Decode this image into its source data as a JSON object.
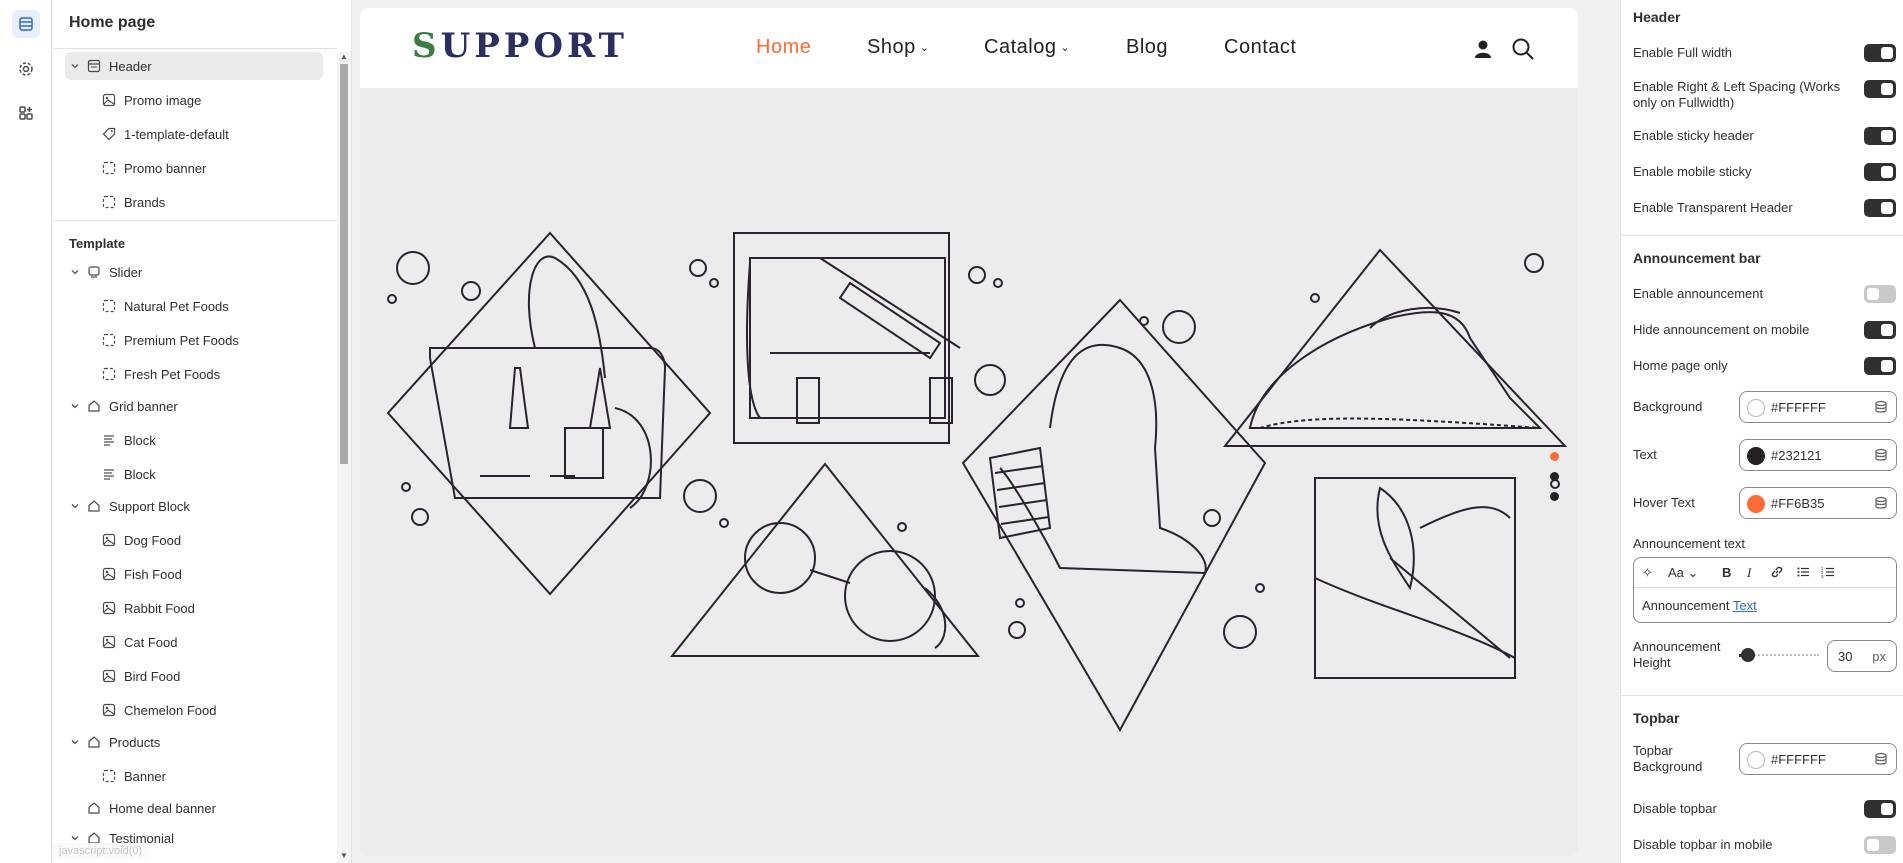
{
  "left_panel": {
    "title": "Home page",
    "header_group": {
      "label": "Header",
      "items": [
        "Promo image",
        "1-template-default",
        "Promo banner",
        "Brands"
      ]
    },
    "template_label": "Template",
    "sections": [
      {
        "label": "Slider",
        "items": [
          "Natural Pet Foods",
          "Premium Pet Foods",
          "Fresh Pet Foods"
        ]
      },
      {
        "label": "Grid banner",
        "items": [
          "Block",
          "Block"
        ]
      },
      {
        "label": "Support Block",
        "items": [
          "Dog Food",
          "Fish Food",
          "Rabbit Food",
          "Cat Food",
          "Bird Food",
          "Chemelon Food"
        ]
      },
      {
        "label": "Products",
        "items": [
          "Banner"
        ]
      },
      {
        "label": "Home deal banner",
        "items": []
      },
      {
        "label": "Testimonial",
        "items": []
      }
    ],
    "status_url": "javascript:void(0)"
  },
  "preview": {
    "logo": "SUPPORT",
    "logo_first": "S",
    "logo_rest": "UPPORT",
    "nav": [
      "Home",
      "Shop",
      "Catalog",
      "Blog",
      "Contact"
    ],
    "nav_active": "Home",
    "nav_dropdowns": [
      "Shop",
      "Catalog"
    ],
    "slide_count": 3,
    "active_slide": 1,
    "accent": "#FF6B35"
  },
  "right_panel": {
    "header_section": {
      "title": "Header",
      "settings": [
        {
          "label": "Enable Full width",
          "on": true
        },
        {
          "label": "Enable Right & Left Spacing (Works only on Fullwidth)",
          "on": true
        },
        {
          "label": "Enable sticky header",
          "on": true
        },
        {
          "label": "Enable mobile sticky",
          "on": true
        },
        {
          "label": "Enable Transparent Header",
          "on": true
        }
      ]
    },
    "announcement_section": {
      "title": "Announcement bar",
      "settings": [
        {
          "label": "Enable announcement",
          "on": false
        },
        {
          "label": "Hide announcement on mobile",
          "on": true
        },
        {
          "label": "Home page only",
          "on": true
        }
      ],
      "colors": [
        {
          "label": "Background",
          "value": "#FFFFFF"
        },
        {
          "label": "Text",
          "value": "#232121"
        },
        {
          "label": "Hover Text",
          "value": "#FF6B35"
        }
      ],
      "announcement_text_label": "Announcement text",
      "announcement_text_plain": "Announcement",
      "announcement_text_link": "Text",
      "height_label": "Announcement Height",
      "height_value": "30",
      "height_unit": "px"
    },
    "topbar_section": {
      "title": "Topbar",
      "background_label": "Topbar Background",
      "background_value": "#FFFFFF",
      "settings": [
        {
          "label": "Disable topbar",
          "on": true
        },
        {
          "label": "Disable topbar in mobile",
          "on": false
        }
      ]
    }
  }
}
